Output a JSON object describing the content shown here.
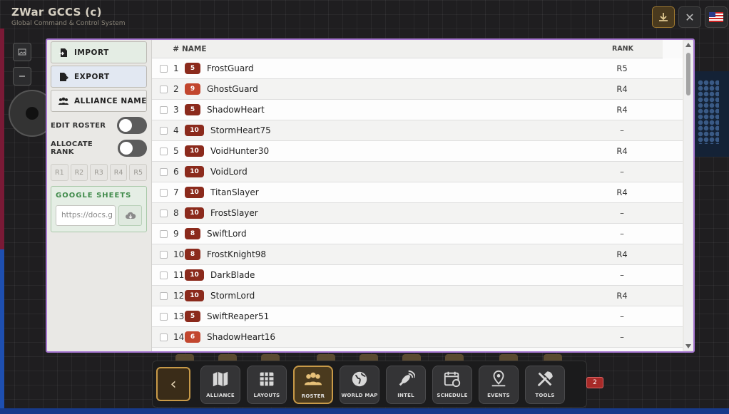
{
  "app": {
    "title": "ZWar GCCS (c)",
    "subtitle": "Global Command & Control System"
  },
  "topbar": {
    "download_icon": "download-icon",
    "close_label": "✕",
    "flag_icon": "us-flag-icon"
  },
  "sidebar": {
    "import_label": "IMPORT",
    "export_label": "EXPORT",
    "alliance_label": "ALLIANCE NAME (EI",
    "edit_roster_label": "EDIT ROSTER",
    "allocate_rank_label": "ALLOCATE RANK",
    "edit_roster_on": false,
    "allocate_rank_on": false,
    "ranks": [
      "R1",
      "R2",
      "R3",
      "R4",
      "R5"
    ],
    "google_sheets_title": "GOOGLE SHEETS",
    "sheets_placeholder": "https://docs.g",
    "cloud_icon": "cloud-download-icon"
  },
  "table": {
    "headers": {
      "num": "#",
      "name": "NAME",
      "rank": "RANK"
    },
    "colors": {
      "badge_default": "#8b2a1c",
      "badge_light": "#c2462e"
    },
    "rows": [
      {
        "num": "1",
        "level": "5",
        "name": "FrostGuard",
        "rank": "R5"
      },
      {
        "num": "2",
        "level": "9",
        "name": "GhostGuard",
        "rank": "R4"
      },
      {
        "num": "3",
        "level": "5",
        "name": "ShadowHeart",
        "rank": "R4"
      },
      {
        "num": "4",
        "level": "10",
        "name": "StormHeart75",
        "rank": "–"
      },
      {
        "num": "5",
        "level": "10",
        "name": "VoidHunter30",
        "rank": "R4"
      },
      {
        "num": "6",
        "level": "10",
        "name": "VoidLord",
        "rank": "–"
      },
      {
        "num": "7",
        "level": "10",
        "name": "TitanSlayer",
        "rank": "R4"
      },
      {
        "num": "8",
        "level": "10",
        "name": "FrostSlayer",
        "rank": "–"
      },
      {
        "num": "9",
        "level": "8",
        "name": "SwiftLord",
        "rank": "–"
      },
      {
        "num": "10",
        "level": "8",
        "name": "FrostKnight98",
        "rank": "R4"
      },
      {
        "num": "11",
        "level": "10",
        "name": "DarkBlade",
        "rank": "–"
      },
      {
        "num": "12",
        "level": "10",
        "name": "StormLord",
        "rank": "R4"
      },
      {
        "num": "13",
        "level": "5",
        "name": "SwiftReaper51",
        "rank": "–"
      },
      {
        "num": "14",
        "level": "6",
        "name": "ShadowHeart16",
        "rank": "–"
      }
    ]
  },
  "nav": {
    "back_label": "‹",
    "items": [
      {
        "label": "ALLIANCE",
        "icon": "map-icon",
        "active": false
      },
      {
        "label": "LAYOUTS",
        "icon": "grid-icon",
        "active": false
      },
      {
        "label": "ROSTER",
        "icon": "users-icon",
        "active": true
      },
      {
        "label": "WORLD MAP",
        "icon": "globe-icon",
        "active": false
      },
      {
        "label": "INTEL",
        "icon": "satellite-icon",
        "active": false
      },
      {
        "label": "SCHEDULE",
        "icon": "calendar-icon",
        "active": false
      },
      {
        "label": "EVENTS",
        "icon": "map-pin-icon",
        "active": false
      },
      {
        "label": "TOOLS",
        "icon": "tools-icon",
        "active": false
      }
    ],
    "badge_count": "2"
  }
}
